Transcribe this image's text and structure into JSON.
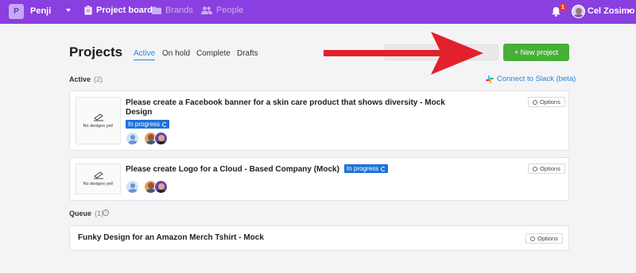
{
  "topbar": {
    "workspace_initial": "P",
    "workspace_name": "Penji",
    "nav": [
      {
        "label": "Project board",
        "icon": "clipboard-icon",
        "active": true
      },
      {
        "label": "Brands",
        "icon": "folder-icon",
        "active": false
      },
      {
        "label": "People",
        "icon": "people-icon",
        "active": false
      }
    ],
    "notification_count": "1",
    "user_name": "Cel Zosimo"
  },
  "header": {
    "title": "Projects",
    "tabs": [
      "Active",
      "On hold",
      "Complete",
      "Drafts"
    ],
    "active_tab": "Active",
    "search_placeholder": "",
    "new_project_label": "+ New project"
  },
  "active_section": {
    "label": "Active",
    "count": "(2)",
    "slack_link": "Connect to Slack (beta)"
  },
  "projects": [
    {
      "title": "Please create a Facebook banner for a skin care product that shows diversity - Mock Design",
      "thumb_text": "No designs yet!",
      "status": "In progress",
      "options_label": "Options"
    },
    {
      "title": "Please create Logo for a Cloud - Based Company (Mock)",
      "thumb_text": "No designs yet!",
      "status": "In progress",
      "options_label": "Options"
    }
  ],
  "queue_section": {
    "label": "Queue",
    "count": "(1)",
    "items": [
      {
        "title": "Funky Design for an Amazon Merch Tshirt - Mock",
        "options_label": "Options"
      }
    ]
  },
  "colors": {
    "topbar": "#8a3fe0",
    "accent": "#1e88e5",
    "new_button": "#45b035",
    "annotation_arrow": "#e3202b",
    "badge": "#1e73d8"
  }
}
